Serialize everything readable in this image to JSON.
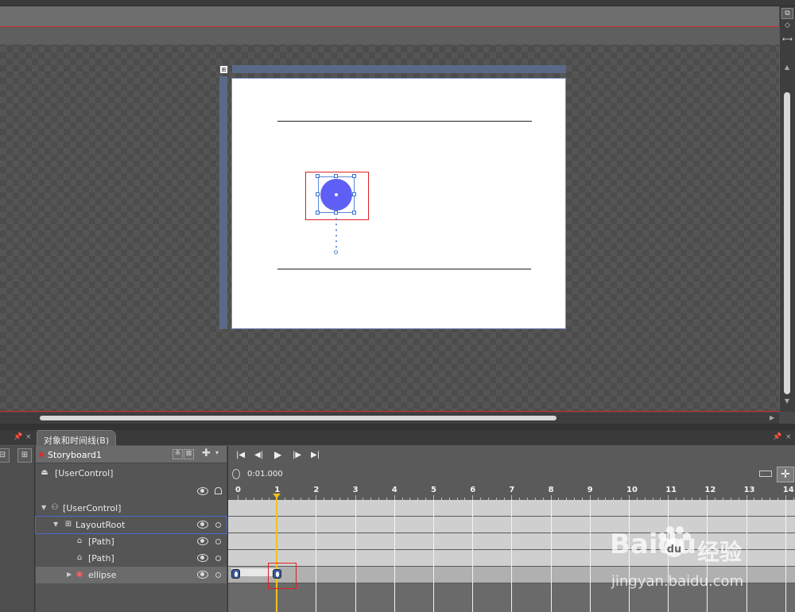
{
  "panel": {
    "tab_label": "对象和时间线(B)",
    "storyboard_name": "Storyboard1",
    "scope": "[UserControl]"
  },
  "tree": {
    "items": [
      {
        "label": "[UserControl]",
        "icon": "user-control-icon"
      },
      {
        "label": "LayoutRoot",
        "icon": "grid-icon"
      },
      {
        "label": "[Path]",
        "icon": "path-icon"
      },
      {
        "label": "[Path]",
        "icon": "path-icon"
      },
      {
        "label": "ellipse",
        "icon": "ellipse-icon"
      }
    ]
  },
  "timeline": {
    "current_time": "0:01.000",
    "ruler": [
      "0",
      "1",
      "2",
      "3",
      "4",
      "5",
      "6",
      "7",
      "8",
      "9",
      "10",
      "11",
      "12",
      "13",
      "14"
    ]
  },
  "watermark": {
    "logo": "Baidu",
    "chinese": "经验",
    "url": "jingyan.baidu.com"
  },
  "colors": {
    "selection_red": "#e02020",
    "ellipse_fill": "#5f5ff5",
    "playhead": "#f0c020",
    "keyframe": "#3b5a9a"
  }
}
